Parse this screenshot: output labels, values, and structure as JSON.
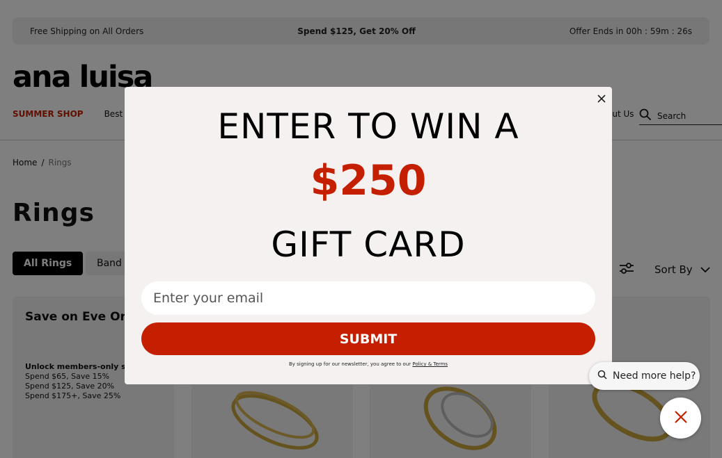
{
  "promo": {
    "left": "Free Shipping on All Orders",
    "center": "Spend $125, Get 20% Off",
    "right": "Offer Ends in 00h : 59m : 26s"
  },
  "brand": {
    "logo": "ana luisa"
  },
  "nav": {
    "items": [
      "SUMMER SHOP",
      "Best Se"
    ],
    "about": "out Us",
    "search_label": "Search"
  },
  "breadcrumb": {
    "home": "Home",
    "separator": "/",
    "current": "Rings"
  },
  "page": {
    "title": "Rings"
  },
  "filters": {
    "chips": [
      "All Rings",
      "Band"
    ],
    "sort_label": "Sort By"
  },
  "promo_card": {
    "title": "Save on Eve Order—Join Luxe",
    "lines": [
      "Unlock members-only savin",
      "Spend $65, Save 15%",
      "Spend $125, Save 20%",
      "Spend $175+, Save 25%"
    ]
  },
  "modal": {
    "line1": "ENTER TO WIN A",
    "amount": "$250",
    "line3": "GIFT CARD",
    "email_placeholder": "Enter your email",
    "submit_label": "SUBMIT",
    "disclaimer_text": "By signing up for our newsletter, you agree to our ",
    "disclaimer_link": "Policy & Terms"
  },
  "help": {
    "label": "Need more help?"
  },
  "colors": {
    "accent": "#c41f00",
    "modal_bg": "#f5f1f1"
  }
}
